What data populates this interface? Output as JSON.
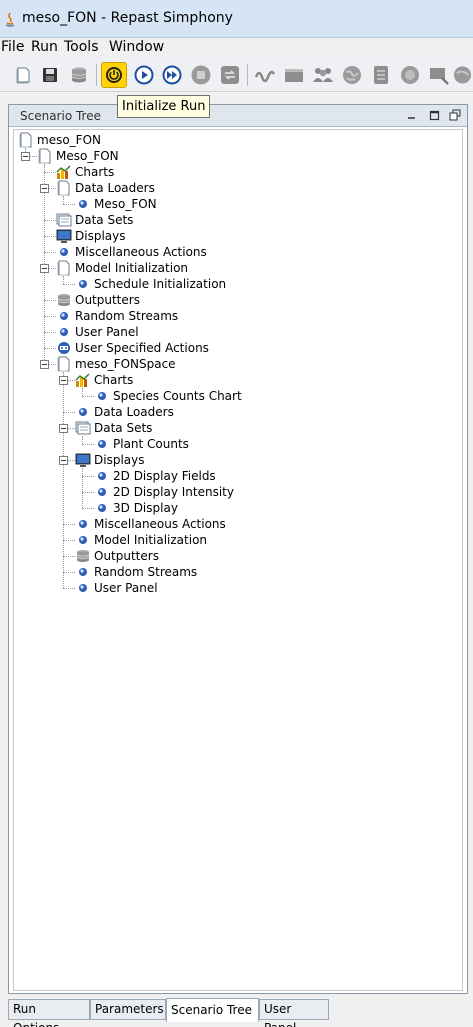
{
  "window": {
    "title": "meso_FON - Repast Simphony"
  },
  "menu": [
    "File",
    "Run",
    "Tools",
    "Window"
  ],
  "toolbar": {
    "buttons": [
      "open-icon",
      "save-icon",
      "database-icon",
      "initialize-run-icon",
      "start-run-icon",
      "step-run-icon",
      "stop-run-icon",
      "reset-run-icon",
      "wave-icon",
      "panel-icon",
      "agents-icon",
      "globe-icon",
      "list-icon",
      "globe-icon",
      "search-icon",
      "globe-icon"
    ],
    "tooltip": "Initialize Run",
    "active_color": "#ffd400"
  },
  "panel": {
    "title": "Scenario Tree"
  },
  "tree": [
    {
      "label": "meso_FON",
      "icon": "document-icon",
      "level": 0
    },
    {
      "label": "Meso_FON",
      "icon": "document-icon",
      "level": 1
    },
    {
      "label": "Charts",
      "icon": "chart-icon",
      "level": 2
    },
    {
      "label": "Data Loaders",
      "icon": "document-icon",
      "level": 2
    },
    {
      "label": "Meso_FON",
      "icon": "bullet-icon",
      "level": 3
    },
    {
      "label": "Data Sets",
      "icon": "datasets-icon",
      "level": 2
    },
    {
      "label": "Displays",
      "icon": "monitor-icon",
      "level": 2
    },
    {
      "label": "Miscellaneous Actions",
      "icon": "bullet-icon",
      "level": 2
    },
    {
      "label": "Model Initialization",
      "icon": "document-icon",
      "level": 2
    },
    {
      "label": "Schedule Initialization",
      "icon": "bullet-icon",
      "level": 3
    },
    {
      "label": "Outputters",
      "icon": "database-icon",
      "level": 2
    },
    {
      "label": "Random Streams",
      "icon": "bullet-icon",
      "level": 2
    },
    {
      "label": "User Panel",
      "icon": "bullet-icon",
      "level": 2
    },
    {
      "label": "User Specified Actions",
      "icon": "user-action-icon",
      "level": 2
    },
    {
      "label": "meso_FONSpace",
      "icon": "document-icon",
      "level": 2
    },
    {
      "label": "Charts",
      "icon": "chart-icon",
      "level": 3
    },
    {
      "label": "Species Counts Chart",
      "icon": "bullet-icon",
      "level": 4
    },
    {
      "label": "Data Loaders",
      "icon": "bullet-icon",
      "level": 3
    },
    {
      "label": "Data Sets",
      "icon": "datasets-icon",
      "level": 3
    },
    {
      "label": "Plant Counts",
      "icon": "bullet-icon",
      "level": 4
    },
    {
      "label": "Displays",
      "icon": "monitor-icon",
      "level": 3
    },
    {
      "label": "2D Display Fields",
      "icon": "bullet-icon",
      "level": 4
    },
    {
      "label": "2D Display Intensity",
      "icon": "bullet-icon",
      "level": 4
    },
    {
      "label": "3D Display",
      "icon": "bullet-icon",
      "level": 4
    },
    {
      "label": "Miscellaneous Actions",
      "icon": "bullet-icon",
      "level": 3
    },
    {
      "label": "Model Initialization",
      "icon": "bullet-icon",
      "level": 3
    },
    {
      "label": "Outputters",
      "icon": "database-icon",
      "level": 3
    },
    {
      "label": "Random Streams",
      "icon": "bullet-icon",
      "level": 3
    },
    {
      "label": "User Panel",
      "icon": "bullet-icon",
      "level": 3
    }
  ],
  "tabs": [
    {
      "label": "Run Options",
      "selected": false
    },
    {
      "label": "Parameters",
      "selected": false
    },
    {
      "label": "Scenario Tree",
      "selected": true
    },
    {
      "label": "User Panel",
      "selected": false
    }
  ]
}
